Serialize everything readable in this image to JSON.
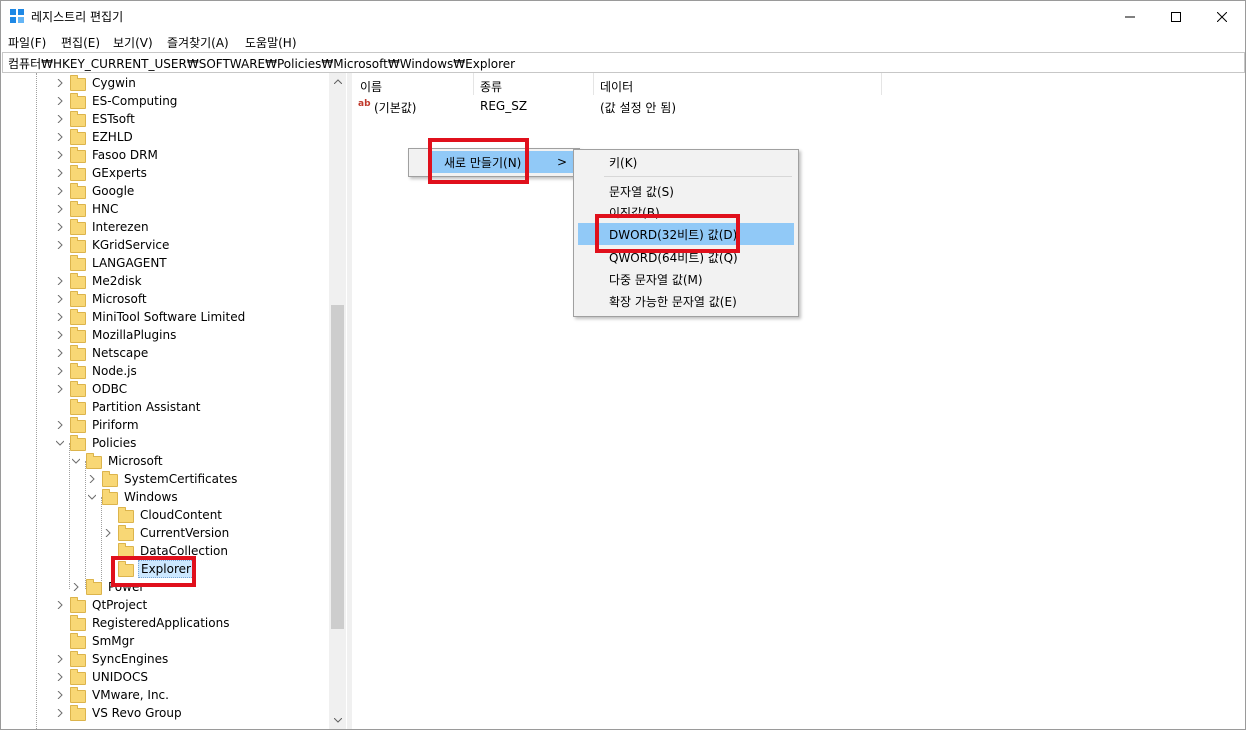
{
  "window": {
    "title": "레지스트리 편집기",
    "minimize_glyph": "—",
    "maximize_glyph": "☐",
    "close_glyph": "✕"
  },
  "menubar": [
    "파일(F)",
    "편집(E)",
    "보기(V)",
    "즐겨찾기(A)",
    "도움말(H)"
  ],
  "address": "컴퓨터₩HKEY_CURRENT_USER₩SOFTWARE₩Policies₩Microsoft₩Windows₩Explorer",
  "tree": {
    "items": [
      {
        "label": "Cygwin",
        "depth": 0,
        "state": "collapsed"
      },
      {
        "label": "ES-Computing",
        "depth": 0,
        "state": "collapsed"
      },
      {
        "label": "ESTsoft",
        "depth": 0,
        "state": "collapsed"
      },
      {
        "label": "EZHLD",
        "depth": 0,
        "state": "collapsed"
      },
      {
        "label": "Fasoo DRM",
        "depth": 0,
        "state": "collapsed"
      },
      {
        "label": "GExperts",
        "depth": 0,
        "state": "collapsed"
      },
      {
        "label": "Google",
        "depth": 0,
        "state": "collapsed"
      },
      {
        "label": "HNC",
        "depth": 0,
        "state": "collapsed"
      },
      {
        "label": "Interezen",
        "depth": 0,
        "state": "collapsed"
      },
      {
        "label": "KGridService",
        "depth": 0,
        "state": "collapsed"
      },
      {
        "label": "LANGAGENT",
        "depth": 0,
        "state": "leaf"
      },
      {
        "label": "Me2disk",
        "depth": 0,
        "state": "collapsed"
      },
      {
        "label": "Microsoft",
        "depth": 0,
        "state": "collapsed"
      },
      {
        "label": "MiniTool Software Limited",
        "depth": 0,
        "state": "collapsed"
      },
      {
        "label": "MozillaPlugins",
        "depth": 0,
        "state": "collapsed"
      },
      {
        "label": "Netscape",
        "depth": 0,
        "state": "collapsed"
      },
      {
        "label": "Node.js",
        "depth": 0,
        "state": "collapsed"
      },
      {
        "label": "ODBC",
        "depth": 0,
        "state": "collapsed"
      },
      {
        "label": "Partition Assistant",
        "depth": 0,
        "state": "leaf"
      },
      {
        "label": "Piriform",
        "depth": 0,
        "state": "collapsed"
      },
      {
        "label": "Policies",
        "depth": 0,
        "state": "expanded"
      },
      {
        "label": "Microsoft",
        "depth": 1,
        "state": "expanded"
      },
      {
        "label": "SystemCertificates",
        "depth": 2,
        "state": "collapsed"
      },
      {
        "label": "Windows",
        "depth": 2,
        "state": "expanded"
      },
      {
        "label": "CloudContent",
        "depth": 3,
        "state": "leaf"
      },
      {
        "label": "CurrentVersion",
        "depth": 3,
        "state": "collapsed"
      },
      {
        "label": "DataCollection",
        "depth": 3,
        "state": "leaf"
      },
      {
        "label": "Explorer",
        "depth": 3,
        "state": "leaf",
        "selected": true
      },
      {
        "label": "Power",
        "depth": 1,
        "state": "collapsed"
      },
      {
        "label": "QtProject",
        "depth": 0,
        "state": "collapsed"
      },
      {
        "label": "RegisteredApplications",
        "depth": 0,
        "state": "leaf"
      },
      {
        "label": "SmMgr",
        "depth": 0,
        "state": "leaf"
      },
      {
        "label": "SyncEngines",
        "depth": 0,
        "state": "collapsed"
      },
      {
        "label": "UNIDOCS",
        "depth": 0,
        "state": "collapsed"
      },
      {
        "label": "VMware, Inc.",
        "depth": 0,
        "state": "collapsed"
      },
      {
        "label": "VS Revo Group",
        "depth": 0,
        "state": "collapsed"
      }
    ]
  },
  "list": {
    "columns": [
      "이름",
      "종류",
      "데이터"
    ],
    "rows": [
      {
        "name": "(기본값)",
        "type": "REG_SZ",
        "data": "(값 설정 안 됨)"
      }
    ]
  },
  "context_menu": {
    "new_label": "새로 만들기(N)",
    "submenu_arrow": ">",
    "submenu": [
      "키(K)",
      "문자열 값(S)",
      "이진값(B)",
      "DWORD(32비트) 값(D)",
      "QWORD(64비트) 값(Q)",
      "다중 문자열 값(M)",
      "확장 가능한 문자열 값(E)"
    ],
    "highlighted_item": "DWORD(32비트) 값(D)"
  },
  "colors": {
    "highlight": "#91c9f7",
    "annotation_red": "#e0101c",
    "folder": "#f8d775"
  }
}
